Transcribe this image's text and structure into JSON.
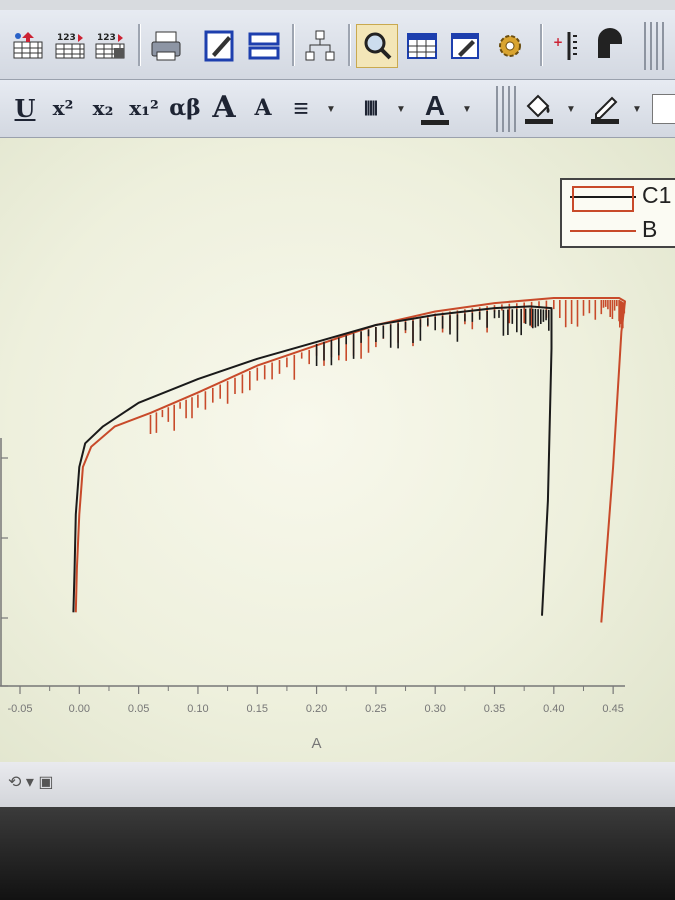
{
  "toolbar_top": {
    "icons": [
      "import-ascii-icon",
      "import-multiple-ascii-icon",
      "import-wizard-icon",
      "print-icon",
      "edit-script-icon",
      "layout-icon",
      "project-explorer-icon",
      "zoom-icon",
      "worksheet-icon",
      "notes-icon",
      "settings-gear-icon",
      "add-layer-icon",
      "new-object-icon"
    ]
  },
  "toolbar_format": {
    "underline": "U",
    "superscript": "x²",
    "subscript": "x₂",
    "supersubscript": "x₁²",
    "greek": "αβ",
    "increase_font": "A",
    "decrease_font": "A",
    "align": "≡",
    "line_width": "|||||",
    "font_color": "A"
  },
  "colors": {
    "series_black": "#1a1a1a",
    "series_red": "#c84a2a",
    "axis": "#777777"
  },
  "chart_data": {
    "type": "line",
    "xlabel": "A",
    "ylabel": "",
    "title": "",
    "xlim": [
      -0.05,
      0.46
    ],
    "x_ticks": [
      "-0.05",
      "0.00",
      "0.05",
      "0.10",
      "0.15",
      "0.20",
      "0.25",
      "0.30",
      "0.35",
      "0.40",
      "0.45"
    ],
    "grid": false,
    "legend_position": "top-right",
    "series": [
      {
        "name": "C1",
        "color": "#1a1a1a",
        "x": [
          -0.005,
          -0.004,
          -0.003,
          0.0,
          0.005,
          0.02,
          0.05,
          0.1,
          0.15,
          0.2,
          0.25,
          0.3,
          0.35,
          0.38,
          0.398,
          0.398,
          0.395,
          0.39
        ],
        "y": [
          0.07,
          0.2,
          0.36,
          0.5,
          0.57,
          0.62,
          0.69,
          0.76,
          0.82,
          0.87,
          0.92,
          0.95,
          0.97,
          0.975,
          0.97,
          0.85,
          0.4,
          0.06
        ]
      },
      {
        "name": "B",
        "color": "#c84a2a",
        "x": [
          -0.003,
          -0.002,
          0.0,
          0.003,
          0.01,
          0.03,
          0.06,
          0.1,
          0.15,
          0.2,
          0.25,
          0.3,
          0.35,
          0.4,
          0.44,
          0.455,
          0.46,
          0.457,
          0.45,
          0.44
        ],
        "y": [
          0.07,
          0.2,
          0.36,
          0.5,
          0.56,
          0.62,
          0.66,
          0.72,
          0.8,
          0.86,
          0.92,
          0.96,
          0.985,
          1.0,
          1.0,
          1.0,
          0.99,
          0.9,
          0.5,
          0.04
        ]
      }
    ]
  },
  "status": {
    "tool_icon": "pointer-tool-icon"
  }
}
